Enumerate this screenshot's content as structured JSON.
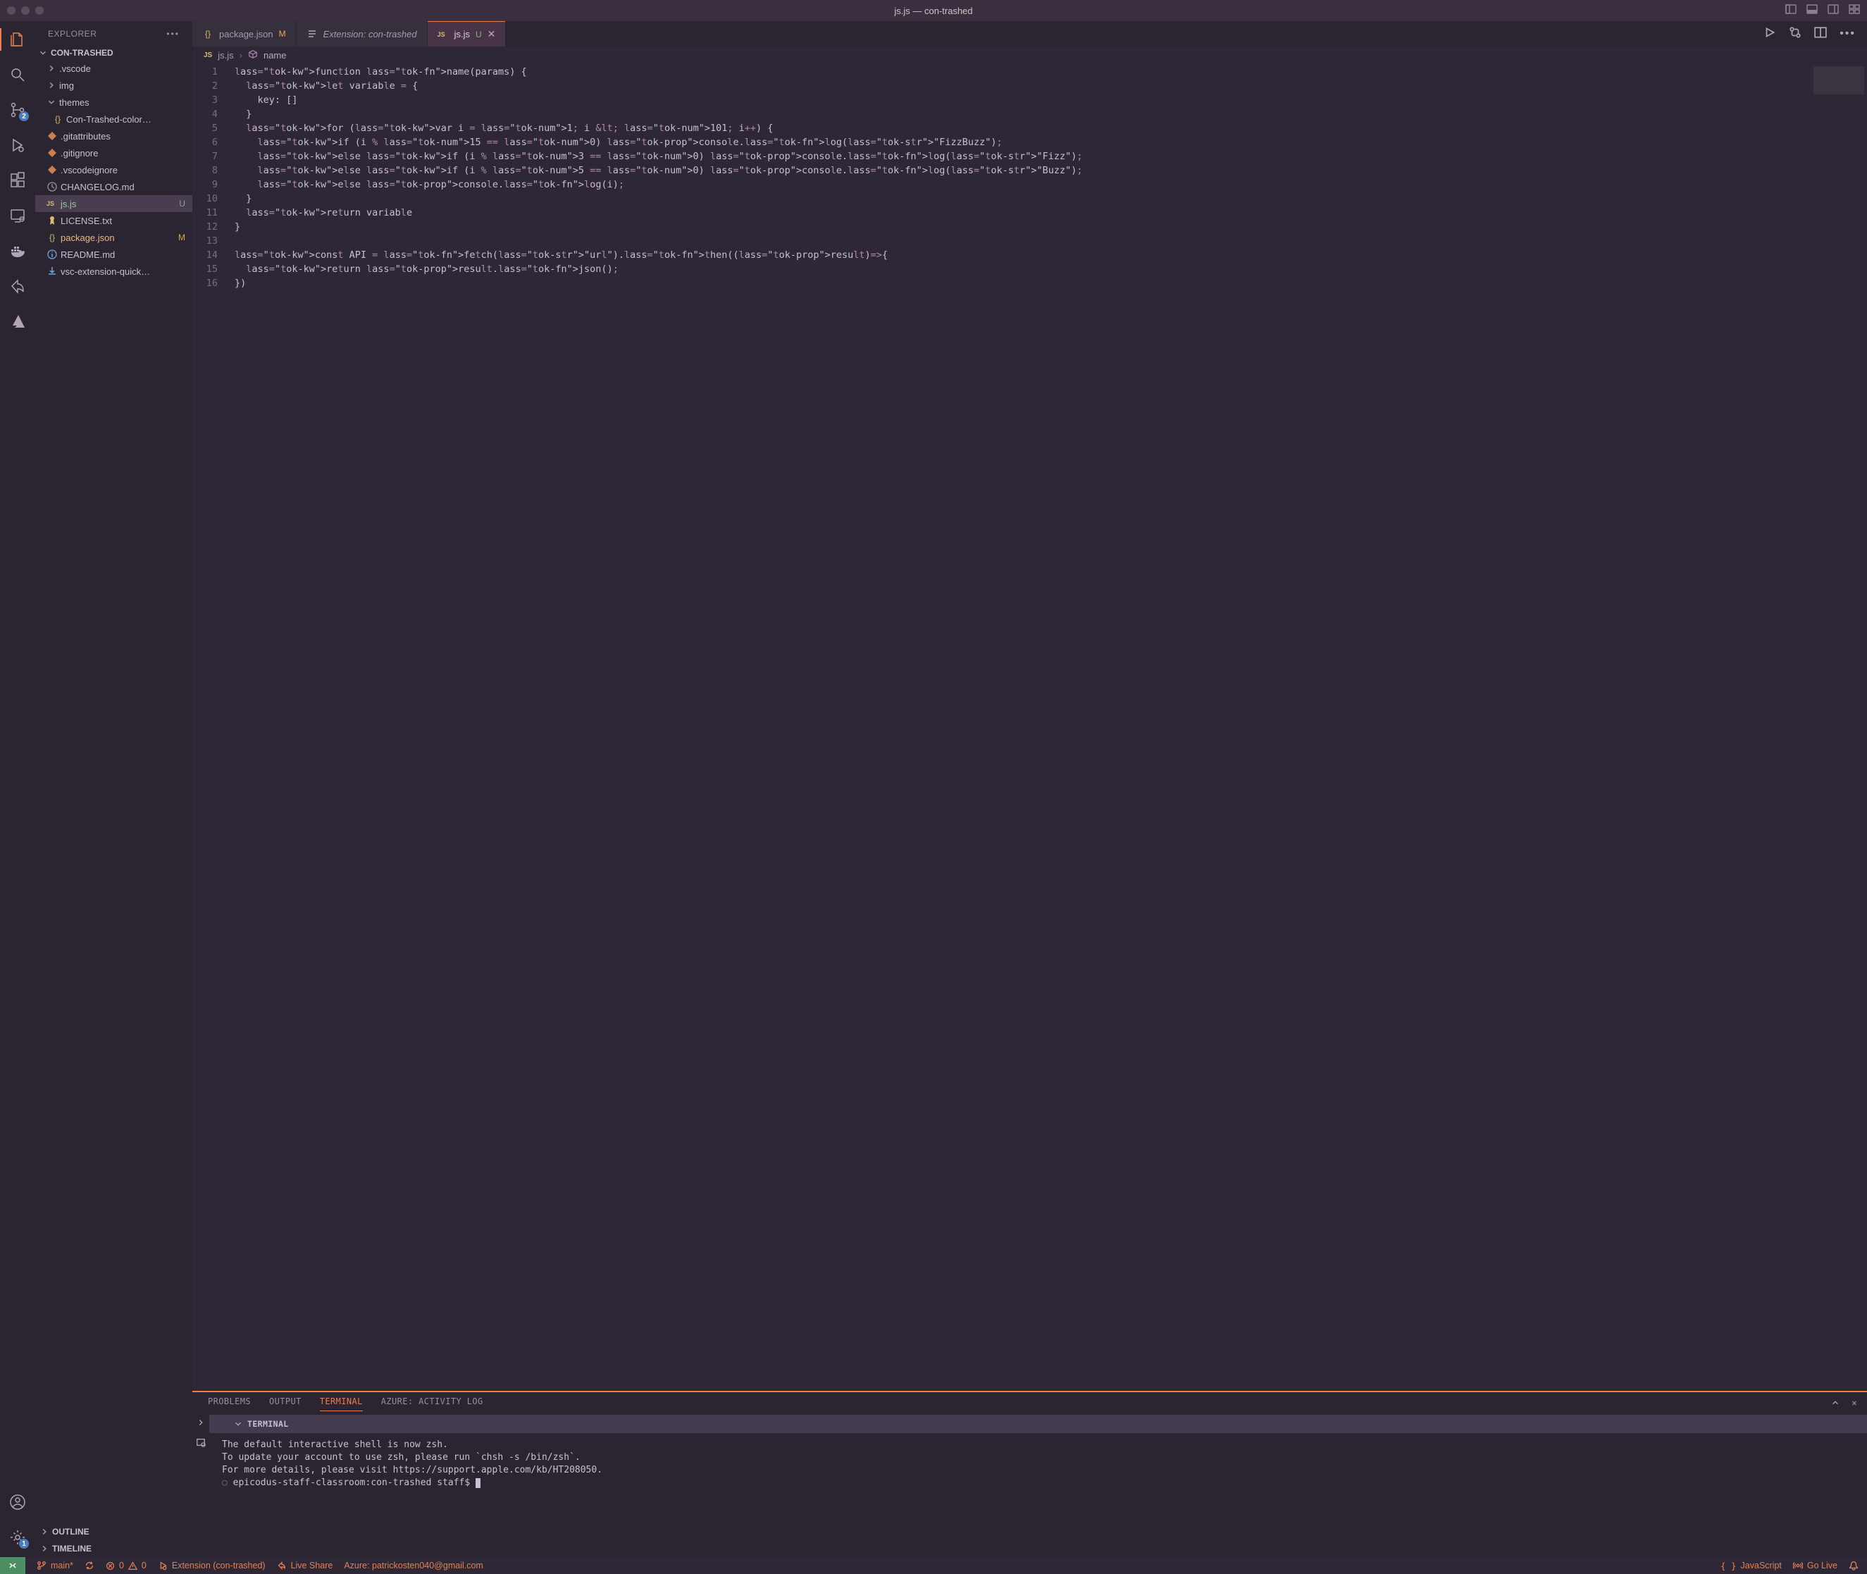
{
  "window": {
    "title": "js.js — con-trashed"
  },
  "explorer": {
    "header": "EXPLORER",
    "folder_name": "CON-TRASHED",
    "items": [
      {
        "label": ".vscode",
        "type": "folder",
        "status": "",
        "icon": "chevron-right"
      },
      {
        "label": "img",
        "type": "folder",
        "status": "",
        "icon": "chevron-right"
      },
      {
        "label": "themes",
        "type": "folder",
        "status": "",
        "icon": "chevron-down"
      },
      {
        "label": "Con-Trashed-color…",
        "type": "file",
        "status": "",
        "icon": "json",
        "indent": 1
      },
      {
        "label": ".gitattributes",
        "type": "file",
        "status": "",
        "icon": "git"
      },
      {
        "label": ".gitignore",
        "type": "file",
        "status": "",
        "icon": "git"
      },
      {
        "label": ".vscodeignore",
        "type": "file",
        "status": "",
        "icon": "git"
      },
      {
        "label": "CHANGELOG.md",
        "type": "file",
        "status": "",
        "icon": "md"
      },
      {
        "label": "js.js",
        "type": "file",
        "status": "U",
        "icon": "js",
        "selected": true,
        "labelClass": "green"
      },
      {
        "label": "LICENSE.txt",
        "type": "file",
        "status": "",
        "icon": "license"
      },
      {
        "label": "package.json",
        "type": "file",
        "status": "M",
        "icon": "json",
        "labelClass": "orange"
      },
      {
        "label": "README.md",
        "type": "file",
        "status": "",
        "icon": "info"
      },
      {
        "label": "vsc-extension-quick…",
        "type": "file",
        "status": "",
        "icon": "download"
      }
    ],
    "outline": "OUTLINE",
    "timeline": "TIMELINE"
  },
  "source_control_badge": "2",
  "settings_badge": "1",
  "tabs": [
    {
      "label": "package.json",
      "status": "M",
      "icon": "json",
      "italic": false,
      "active": false
    },
    {
      "label": "Extension: con-trashed",
      "status": "",
      "icon": "doc",
      "italic": true,
      "active": false
    },
    {
      "label": "js.js",
      "status": "U",
      "icon": "js",
      "italic": false,
      "active": true,
      "closable": true
    }
  ],
  "breadcrumbs": {
    "file": "js.js",
    "symbol": "name"
  },
  "code": {
    "lines": [
      "function name(params) {",
      "  let variable = {",
      "    key: []",
      "  }",
      "  for (var i = 1; i < 101; i++) {",
      "    if (i % 15 == 0) console.log(\"FizzBuzz\");",
      "    else if (i % 3 == 0) console.log(\"Fizz\");",
      "    else if (i % 5 == 0) console.log(\"Buzz\");",
      "    else console.log(i);",
      "  }",
      "  return variable",
      "}",
      "",
      "const API = fetch(\"url\").then((result)=>{",
      "  return result.json();",
      "})"
    ]
  },
  "panel": {
    "tabs": [
      "PROBLEMS",
      "OUTPUT",
      "TERMINAL",
      "AZURE: ACTIVITY LOG"
    ],
    "active_tab": "TERMINAL",
    "section_header": "TERMINAL",
    "terminal_lines": [
      "The default interactive shell is now zsh.",
      "To update your account to use zsh, please run `chsh -s /bin/zsh`.",
      "For more details, please visit https://support.apple.com/kb/HT208050.",
      "epicodus-staff-classroom:con-trashed staff$ "
    ]
  },
  "status": {
    "branch": "main*",
    "errors": "0",
    "warnings": "0",
    "extension": "Extension (con-trashed)",
    "live_share": "Live Share",
    "azure": "Azure: patrickosten040@gmail.com",
    "language": "JavaScript",
    "go_live": "Go Live"
  }
}
